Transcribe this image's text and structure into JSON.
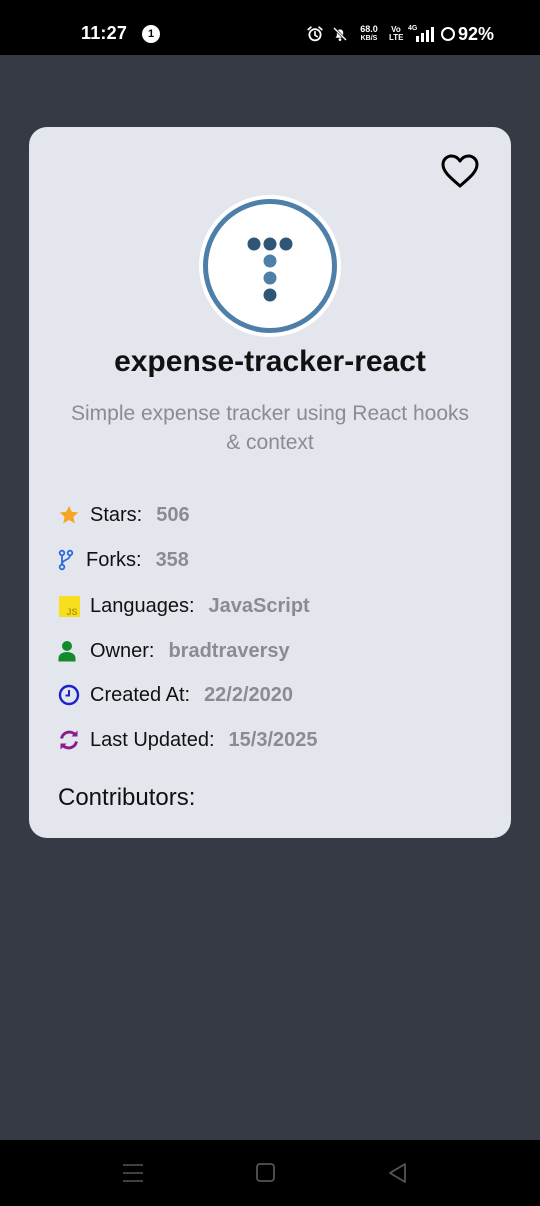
{
  "status_bar": {
    "time": "11:27",
    "notification_count": "1",
    "net_speed_value": "68.0",
    "net_speed_unit": "KB/S",
    "volte_top": "Vo",
    "volte_bottom": "LTE",
    "network_type": "4G",
    "battery": "92%"
  },
  "repo": {
    "name": "expense-tracker-react",
    "description": "Simple expense tracker using React hooks & context",
    "favorite_icon": "heart-outline-icon"
  },
  "details": [
    {
      "icon": "star-icon",
      "label": "Stars:",
      "value": "506",
      "color": "#f5a623"
    },
    {
      "icon": "fork-icon",
      "label": "Forks:",
      "value": "358",
      "color": "#2f6ad9"
    },
    {
      "icon": "javascript-icon",
      "label": "Languages:",
      "value": "JavaScript",
      "color": "#f7df1e"
    },
    {
      "icon": "user-icon",
      "label": "Owner:",
      "value": "bradtraversy",
      "color": "#138a2c"
    },
    {
      "icon": "clock-icon",
      "label": "Created At:",
      "value": "22/2/2020",
      "color": "#1a22c9"
    },
    {
      "icon": "sync-icon",
      "label": "Last Updated:",
      "value": "15/3/2025",
      "color": "#8b1a8b"
    }
  ],
  "contributors_heading": "Contributors:",
  "js_badge_text": "JS",
  "colors": {
    "background": "#363a44",
    "card": "#e4e6ee",
    "avatar_ring": "#4e7fa9",
    "muted_text": "#8a8c93"
  },
  "nav": {
    "recents_icon": "menu-lines-icon",
    "home_icon": "square-icon",
    "back_icon": "triangle-back-icon"
  }
}
